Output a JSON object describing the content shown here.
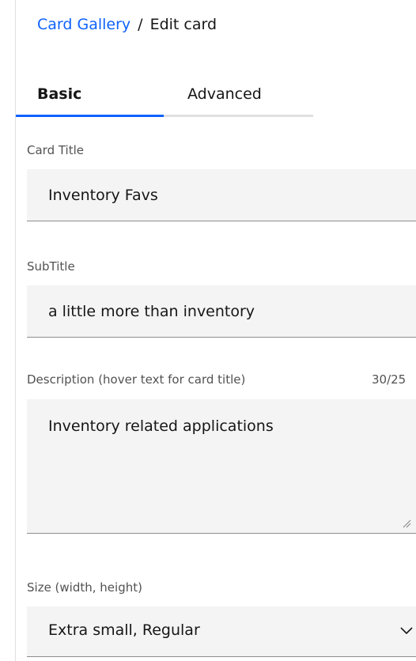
{
  "breadcrumb": {
    "parent": "Card Gallery",
    "separator": "/",
    "current": "Edit card"
  },
  "tabs": [
    {
      "label": "Basic",
      "selected": true
    },
    {
      "label": "Advanced",
      "selected": false
    }
  ],
  "form": {
    "card_title": {
      "label": "Card Title",
      "value": "Inventory Favs"
    },
    "subtitle": {
      "label": "SubTitle",
      "value": "a little more than inventory"
    },
    "description": {
      "label": "Description (hover text for card title)",
      "counter": "30/25",
      "value": "Inventory related applications"
    },
    "size": {
      "label": "Size (width, height)",
      "value": "Extra small, Regular"
    }
  },
  "colors": {
    "accent": "#0f62fe",
    "field_bg": "#f4f4f4",
    "label": "#525252",
    "text": "#161616"
  },
  "icons": {
    "size_select": "chevron-down-icon",
    "description_resize": "resize-handle-icon"
  }
}
